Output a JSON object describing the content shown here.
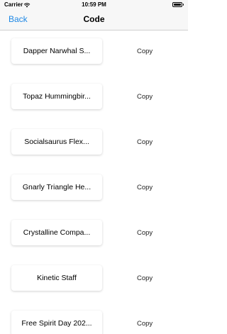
{
  "status_bar": {
    "carrier": "Carrier",
    "time": "10:59 PM"
  },
  "nav": {
    "back_label": "Back",
    "title": "Code"
  },
  "items": [
    {
      "name": "Dapper Narwhal S...",
      "action": "Copy"
    },
    {
      "name": "Topaz Hummingbir...",
      "action": "Copy"
    },
    {
      "name": "Socialsaurus Flex...",
      "action": "Copy"
    },
    {
      "name": "Gnarly Triangle He...",
      "action": "Copy"
    },
    {
      "name": "Crystalline Compa...",
      "action": "Copy"
    },
    {
      "name": "Kinetic Staff",
      "action": "Copy"
    },
    {
      "name": "Free Spirit Day 202...",
      "action": "Copy"
    }
  ],
  "colors": {
    "accent": "#1e88e5",
    "bar_background": "#f7f7f7"
  }
}
